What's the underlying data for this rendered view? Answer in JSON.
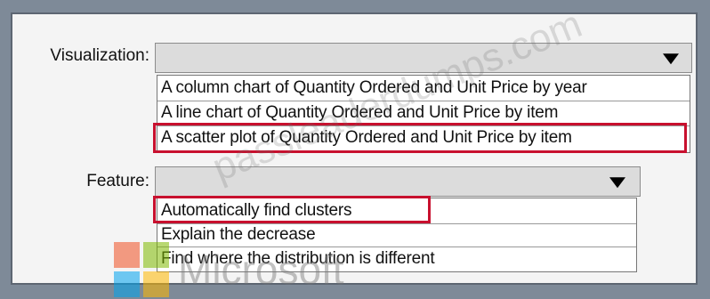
{
  "visualization": {
    "label": "Visualization:",
    "selected": "",
    "options": [
      "A column chart of Quantity Ordered and Unit Price by year",
      "A line chart of Quantity Ordered and Unit Price by item",
      "A scatter plot of Quantity Ordered and Unit Price by item"
    ]
  },
  "feature": {
    "label": "Feature:",
    "selected": "",
    "options": [
      "Automatically find clusters",
      "Explain the decrease",
      "Find where the distribution is different"
    ]
  },
  "watermark": {
    "text": "passleaderdumps.com",
    "logo_text": "Microsoft"
  },
  "colors": {
    "highlight": "#c8102e",
    "background": "#7e8a98",
    "dropdown": "#dcdcdc"
  },
  "icons": {
    "dropdown": "triangle-down-icon"
  }
}
